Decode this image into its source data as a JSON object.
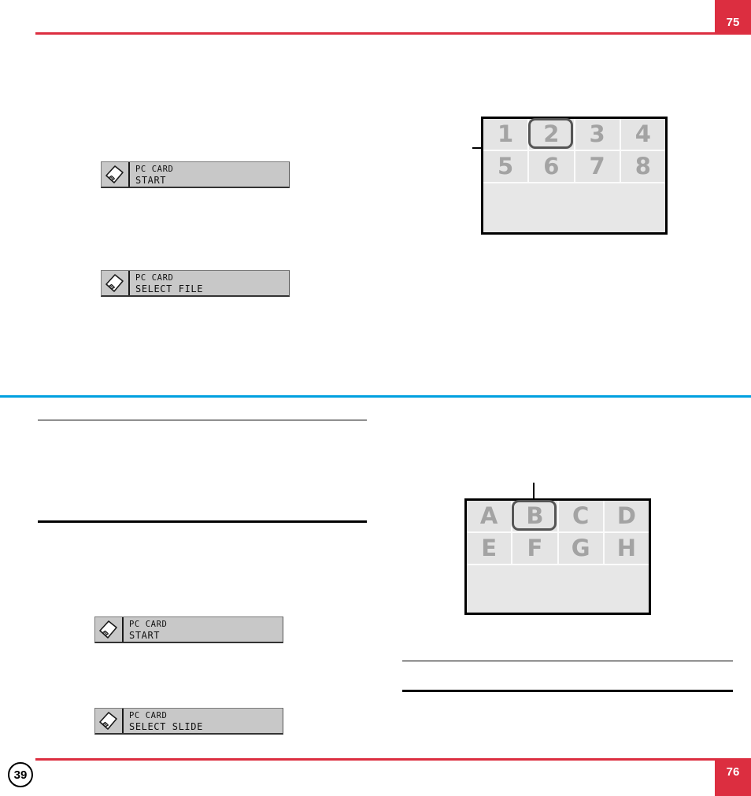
{
  "document": {
    "header_page_number": "75",
    "footer_page_number": "76",
    "page_badge": "39",
    "accent_red": "#DC2E40",
    "accent_cyan": "#00A0E0"
  },
  "osd_messages": [
    {
      "icon": "pc-card-icon",
      "line1": "PC CARD",
      "line2": "START"
    },
    {
      "icon": "pc-card-icon",
      "line1": "PC CARD",
      "line2": "SELECT FILE"
    },
    {
      "icon": "pc-card-icon",
      "line1": "PC CARD",
      "line2": "START"
    },
    {
      "icon": "pc-card-icon",
      "line1": "PC CARD",
      "line2": "SELECT SLIDE"
    }
  ],
  "grids": {
    "numbers": {
      "row1": [
        "1",
        "2",
        "3",
        "4"
      ],
      "row2": [
        "5",
        "6",
        "7",
        "8"
      ],
      "selected": "2",
      "cell_color": "#e4e4e4",
      "text_color": "#a3a3a3",
      "highlight_color": "#555555"
    },
    "letters": {
      "row1": [
        "A",
        "B",
        "C",
        "D"
      ],
      "row2": [
        "E",
        "F",
        "G",
        "H"
      ],
      "selected": "B",
      "cell_color": "#e4e4e4",
      "text_color": "#a3a3a3",
      "highlight_color": "#555555"
    }
  }
}
